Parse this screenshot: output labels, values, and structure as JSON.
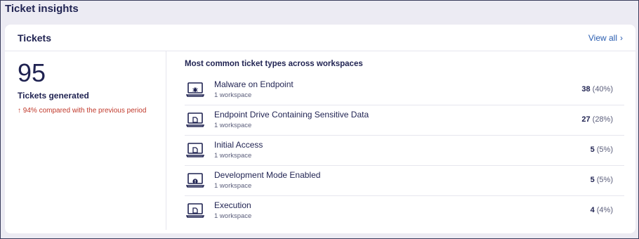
{
  "page": {
    "title": "Ticket insights"
  },
  "card": {
    "title": "Tickets",
    "view_all": "View all",
    "chevron": "›"
  },
  "summary": {
    "count": "95",
    "label": "Tickets generated",
    "change": "↑ 94% compared with the previous period",
    "change_color": "#c0392b"
  },
  "types": {
    "title": "Most common ticket types across workspaces",
    "items": [
      {
        "name": "Malware on Endpoint",
        "sub": "1 workspace",
        "count": "38",
        "pct": "(40%)",
        "icon": "laptop-bug-icon"
      },
      {
        "name": "Endpoint Drive Containing Sensitive Data",
        "sub": "1 workspace",
        "count": "27",
        "pct": "(28%)",
        "icon": "laptop-file-icon"
      },
      {
        "name": "Initial Access",
        "sub": "1 workspace",
        "count": "5",
        "pct": "(5%)",
        "icon": "laptop-file-icon"
      },
      {
        "name": "Development Mode Enabled",
        "sub": "1 workspace",
        "count": "5",
        "pct": "(5%)",
        "icon": "laptop-alert-icon"
      },
      {
        "name": "Execution",
        "sub": "1 workspace",
        "count": "4",
        "pct": "(4%)",
        "icon": "laptop-file-icon"
      }
    ]
  }
}
